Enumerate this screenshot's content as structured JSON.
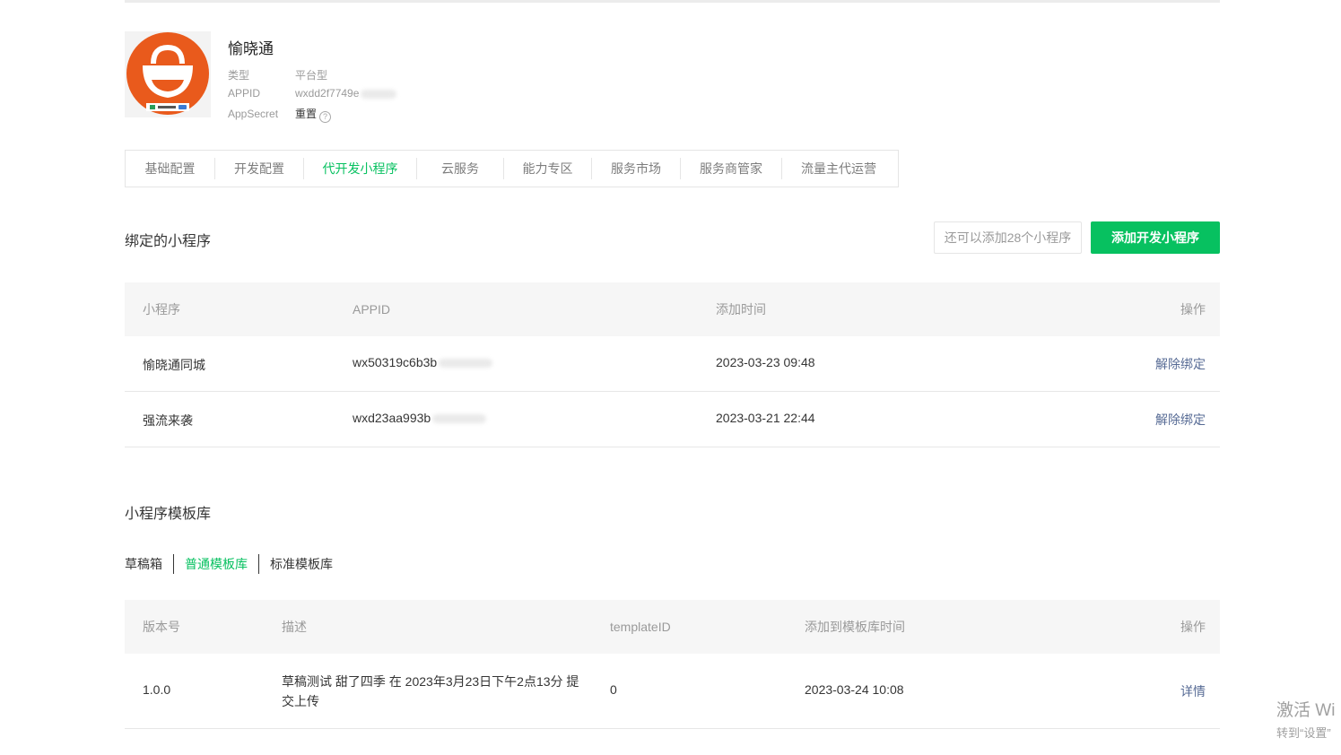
{
  "app": {
    "name": "愉晓通",
    "type_label": "类型",
    "type_value": "平台型",
    "appid_label": "APPID",
    "appid_value": "wxdd2f7749e",
    "secret_label": "AppSecret",
    "secret_action": "重置",
    "logo_text": "愉晓通"
  },
  "tabs": [
    {
      "label": "基础配置"
    },
    {
      "label": "开发配置"
    },
    {
      "label": "代开发小程序",
      "active": true
    },
    {
      "label": "云服务"
    },
    {
      "label": "能力专区"
    },
    {
      "label": "服务市场"
    },
    {
      "label": "服务商管家"
    },
    {
      "label": "流量主代运营"
    }
  ],
  "bound": {
    "title": "绑定的小程序",
    "quota_text": "还可以添加28个小程序",
    "add_button": "添加开发小程序",
    "headers": {
      "name": "小程序",
      "appid": "APPID",
      "time": "添加时间",
      "action": "操作"
    },
    "rows": [
      {
        "name": "愉晓通同城",
        "appid": "wx50319c6b3b",
        "time": "2023-03-23 09:48",
        "action": "解除绑定"
      },
      {
        "name": "强流来袭",
        "appid": "wxd23aa993b",
        "time": "2023-03-21 22:44",
        "action": "解除绑定"
      }
    ]
  },
  "templates": {
    "title": "小程序模板库",
    "subtabs": [
      {
        "label": "草稿箱"
      },
      {
        "label": "普通模板库",
        "active": true
      },
      {
        "label": "标准模板库"
      }
    ],
    "headers": {
      "version": "版本号",
      "desc": "描述",
      "template_id": "templateID",
      "time": "添加到模板库时间",
      "action": "操作"
    },
    "rows": [
      {
        "version": "1.0.0",
        "desc_line1": "草稿测试 甜了四季 在 2023年3月23日下午2点13分 提",
        "desc_line2": "交上传",
        "template_id": "0",
        "time": "2023-03-24 10:08",
        "action": "详情"
      }
    ]
  },
  "watermark": {
    "line1": "激活 Wi",
    "line2": "转到“设置”"
  },
  "colors": {
    "accent": "#07c160",
    "link": "#576b95",
    "logo_orange": "#e95a1c"
  }
}
